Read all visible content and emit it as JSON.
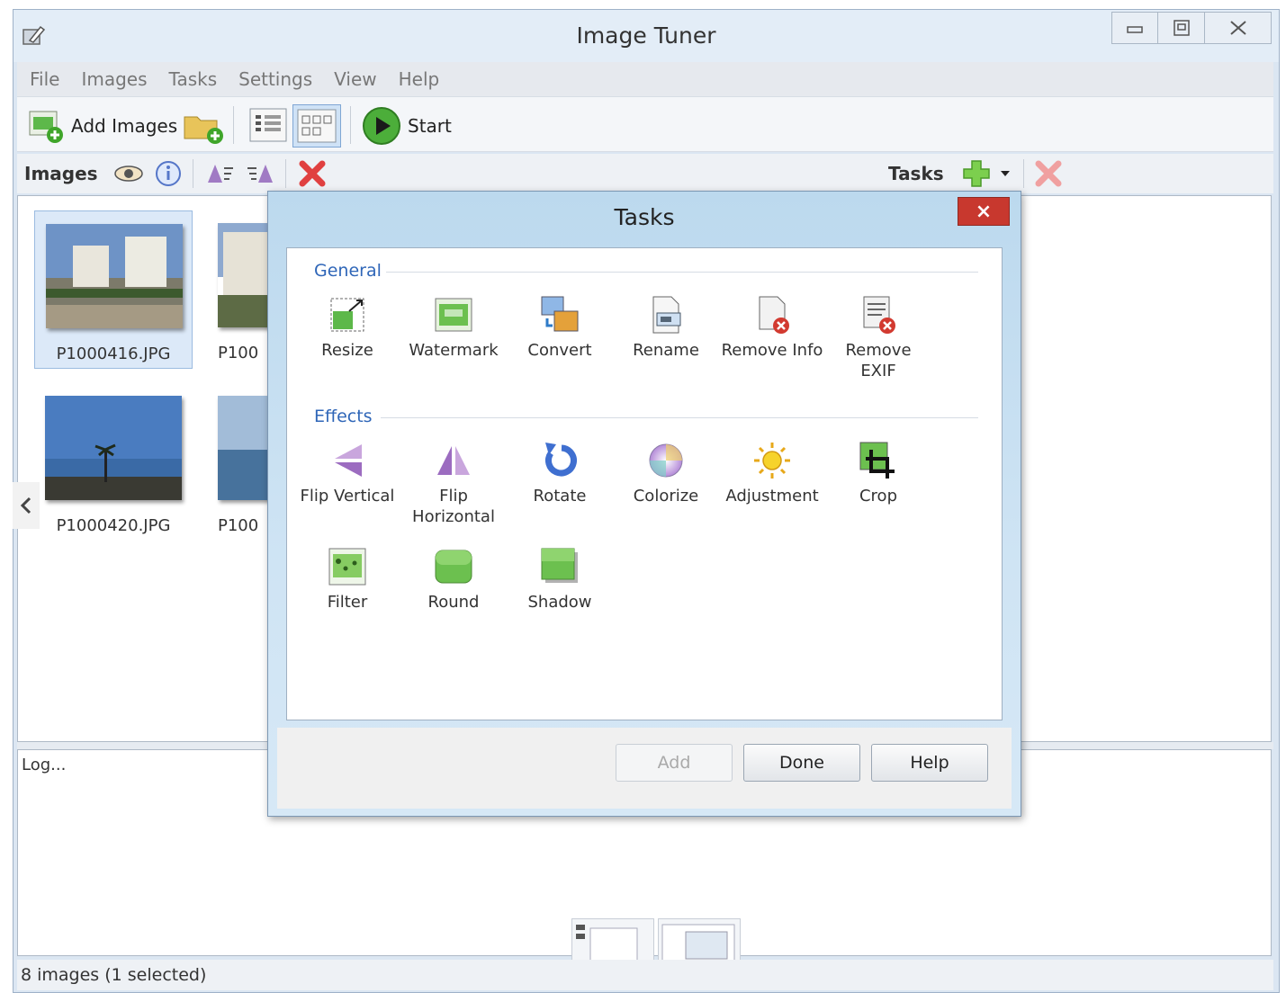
{
  "window": {
    "title": "Image Tuner"
  },
  "menu": [
    "File",
    "Images",
    "Tasks",
    "Settings",
    "View",
    "Help"
  ],
  "toolbar": {
    "add_images": "Add Images",
    "start": "Start"
  },
  "images_bar": {
    "label": "Images",
    "tasks_label": "Tasks"
  },
  "thumbnails": [
    {
      "caption": "P1000416.JPG",
      "selected": true
    },
    {
      "caption": "P100",
      "selected": false
    },
    {
      "caption": "P1000420.JPG",
      "selected": false
    },
    {
      "caption": "P100",
      "selected": false
    }
  ],
  "log": {
    "text": "Log..."
  },
  "status": {
    "text": "8 images (1 selected)"
  },
  "dialog": {
    "title": "Tasks",
    "close": "×",
    "groups": {
      "general": {
        "heading": "General",
        "tasks": [
          {
            "label": "Resize",
            "icon": "resize-icon"
          },
          {
            "label": "Watermark",
            "icon": "watermark-icon"
          },
          {
            "label": "Convert",
            "icon": "convert-icon"
          },
          {
            "label": "Rename",
            "icon": "rename-icon"
          },
          {
            "label": "Remove Info",
            "icon": "remove-info-icon"
          },
          {
            "label": "Remove EXIF",
            "icon": "remove-exif-icon"
          }
        ]
      },
      "effects": {
        "heading": "Effects",
        "tasks": [
          {
            "label": "Flip Vertical",
            "icon": "flip-vertical-icon"
          },
          {
            "label": "Flip Horizontal",
            "icon": "flip-horizontal-icon"
          },
          {
            "label": "Rotate",
            "icon": "rotate-icon"
          },
          {
            "label": "Colorize",
            "icon": "colorize-icon"
          },
          {
            "label": "Adjustment",
            "icon": "adjustment-icon"
          },
          {
            "label": "Crop",
            "icon": "crop-icon"
          },
          {
            "label": "Filter",
            "icon": "filter-icon"
          },
          {
            "label": "Round",
            "icon": "round-icon"
          },
          {
            "label": "Shadow",
            "icon": "shadow-icon"
          }
        ]
      }
    },
    "buttons": {
      "add": "Add",
      "done": "Done",
      "help": "Help"
    }
  },
  "colors": {
    "accent": "#2f66b8",
    "close_red": "#c8382e",
    "start_green": "#3fa52a",
    "delete_red": "#e04040"
  }
}
